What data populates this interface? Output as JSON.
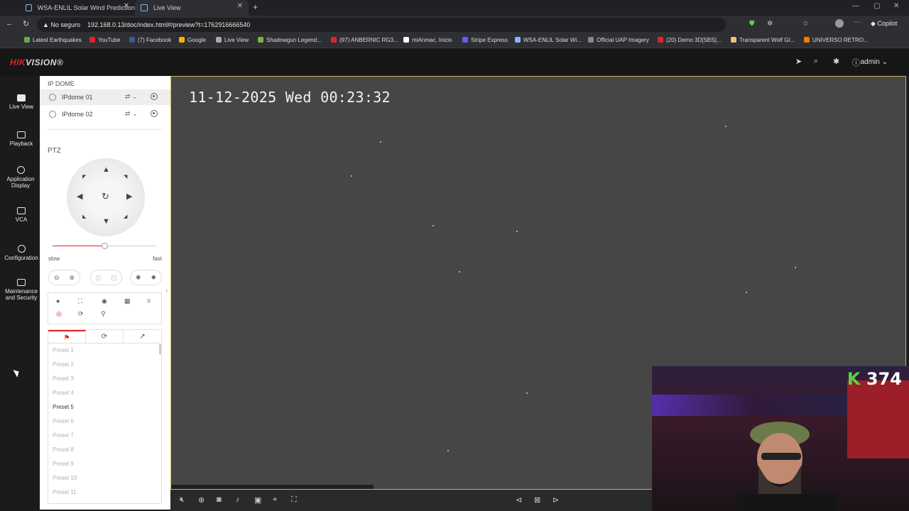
{
  "browser": {
    "tabs": [
      {
        "title": "WSA-ENLIL Solar Wind Prediction",
        "active": false
      },
      {
        "title": "Live View",
        "active": true
      }
    ],
    "url_security": "No seguro",
    "url": "192.168.0.13/doc/index.html#/preview?t=1762916666540",
    "copilot_label": "Copilot",
    "bookmarks": [
      "Latest Earthquakes",
      "YouTube",
      "(7) Facebook",
      "Google",
      "Live View",
      "Shadowgun Legend...",
      "(97) ANBERNIC RG3...",
      "miAnmac. Inicio",
      "Stripe Express",
      "WSA-ENLIL Solar Wi...",
      "Official UAP Imagery",
      "(20) Demo 3D[SBS]...",
      "Transparent Wolf Gl...",
      "UNIVERSO RETRO..."
    ]
  },
  "app": {
    "logo_red": "HIK",
    "logo_rest": "VISION",
    "logo_mark": "®",
    "user": "admin",
    "nav": [
      {
        "label": "Live View",
        "icon": "live-view-icon"
      },
      {
        "label": "Playback",
        "icon": "playback-icon"
      },
      {
        "label": "Application Display",
        "icon": "application-icon"
      },
      {
        "label": "VCA",
        "icon": "vca-icon"
      },
      {
        "label": "Configuration",
        "icon": "gear-icon"
      },
      {
        "label": "Maintenance and Security",
        "icon": "shield-icon"
      }
    ]
  },
  "panel": {
    "group_title": "IP DOME",
    "cameras": [
      {
        "name": "IPdome 01",
        "active": true
      },
      {
        "name": "IPdome 02",
        "active": false
      }
    ],
    "ptz_title": "PTZ",
    "speed_min": "slow",
    "speed_max": "fast",
    "speed_value": 0.5,
    "presets": [
      "Preset 1",
      "Preset 2",
      "Preset 3",
      "Preset 4",
      "Preset 5",
      "Preset 6",
      "Preset 7",
      "Preset 8",
      "Preset 9",
      "Preset 10",
      "Preset 11"
    ],
    "active_preset_index": 4
  },
  "video": {
    "osd_timestamp": "11-12-2025 Wed 00:23:32"
  },
  "overlay": {
    "k": "K",
    "count": "374"
  },
  "colors": {
    "accent": "#e0242a",
    "video_bg": "#464646",
    "badge_green": "#5ccf49"
  }
}
